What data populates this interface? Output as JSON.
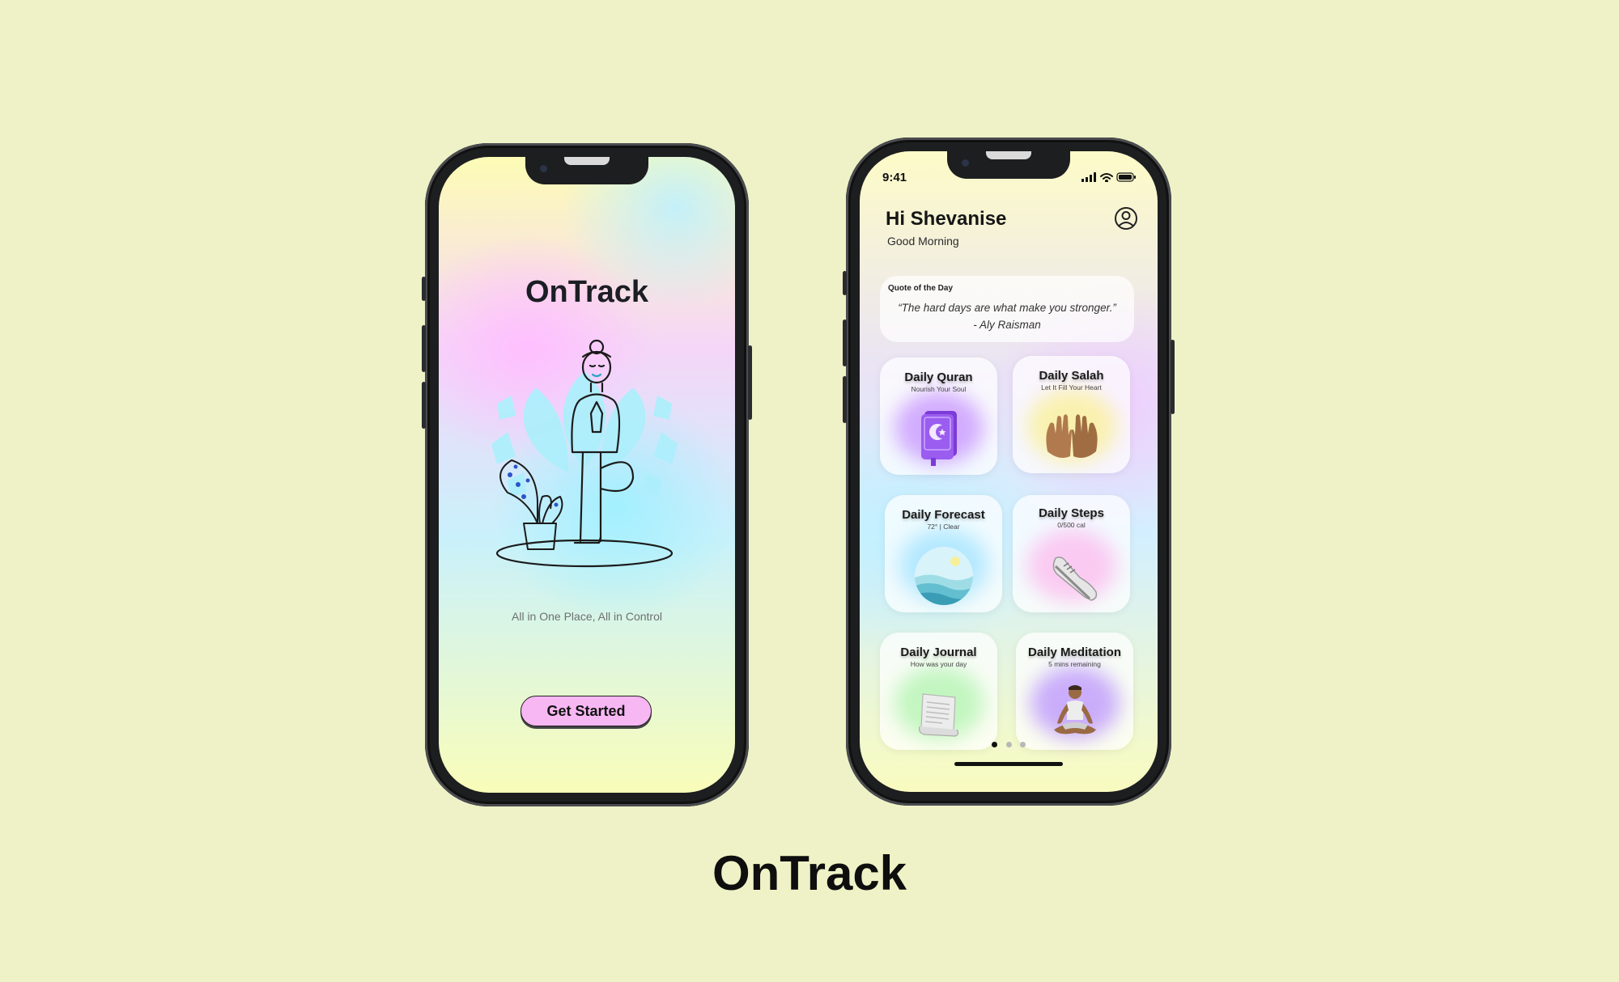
{
  "onboarding": {
    "title": "OnTrack",
    "tagline": "All in One Place, All in Control",
    "cta_label": "Get Started"
  },
  "home": {
    "status_time": "9:41",
    "greeting": "Hi Shevanise",
    "greeting_sub": "Good Morning",
    "quote": {
      "label": "Quote of the Day",
      "text": "“The hard days are what make you stronger.”",
      "author": "- Aly Raisman"
    },
    "cards": [
      {
        "title": "Daily Quran",
        "subtitle": "Nourish Your Soul",
        "icon": "quran-book-icon"
      },
      {
        "title": "Daily Salah",
        "subtitle": "Let It Fill Your Heart",
        "icon": "praying-hands-icon"
      },
      {
        "title": "Daily Forecast",
        "subtitle": "72° | Clear",
        "icon": "weather-landscape-icon"
      },
      {
        "title": "Daily Steps",
        "subtitle": "0/500 cal",
        "icon": "sneaker-icon"
      },
      {
        "title": "Daily Journal",
        "subtitle": "How was your day",
        "icon": "journal-scroll-icon"
      },
      {
        "title": "Daily Meditation",
        "subtitle": "5 mins remaining",
        "icon": "meditation-person-icon"
      }
    ],
    "page_dots": {
      "count": 3,
      "active": 1
    }
  },
  "brand_title": "OnTrack",
  "colors": {
    "background": "#eff2c6",
    "cta": "#f7b7f3",
    "phone_frame": "#1d1e20"
  }
}
